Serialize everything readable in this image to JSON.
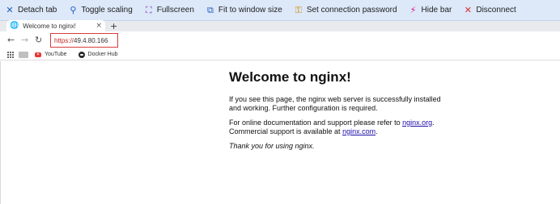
{
  "toolbar": {
    "items": [
      {
        "label": "Detach tab",
        "icon": "crossed-arrows-icon",
        "color": "#1f5bbf"
      },
      {
        "label": "Toggle scaling",
        "icon": "magnifier-icon",
        "color": "#1f5bbf"
      },
      {
        "label": "Fullscreen",
        "icon": "fullscreen-icon",
        "color": "#7b2fbf"
      },
      {
        "label": "Fit to window size",
        "icon": "fit-window-icon",
        "color": "#1f5bbf"
      },
      {
        "label": "Set connection password",
        "icon": "key-icon",
        "color": "#d08a00"
      },
      {
        "label": "Hide bar",
        "icon": "lightning-icon",
        "color": "#d81b8a"
      },
      {
        "label": "Disconnect",
        "icon": "close-x-icon",
        "color": "#d32f2f"
      }
    ]
  },
  "tab": {
    "title": "Welcome to nginx!",
    "close": "×",
    "new_tab": "+"
  },
  "address": {
    "scheme": "https://",
    "host": "49.4.80.166"
  },
  "bookmarks": {
    "youtube": "YouTube",
    "docker": "Docker Hub"
  },
  "page": {
    "heading": "Welcome to nginx!",
    "p1": "If you see this page, the nginx web server is successfully installed and working. Further configuration is required.",
    "p2_text": "For online documentation and support please refer to ",
    "p2_link": "nginx.org",
    "p2_mid": ". Commercial support is available at ",
    "p2_link2": "nginx.com",
    "p2_end": ".",
    "p3": "Thank you for using nginx."
  }
}
